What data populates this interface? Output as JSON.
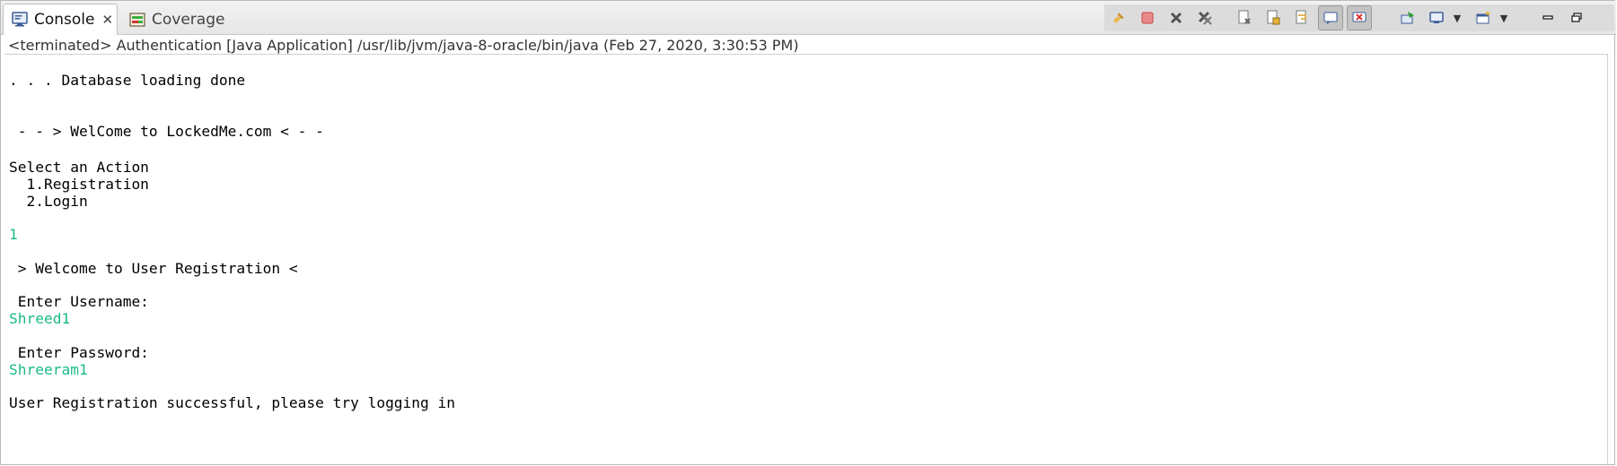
{
  "tabs": [
    {
      "label": "Console",
      "active": true,
      "close_glyph": "✕"
    },
    {
      "label": "Coverage",
      "active": false
    }
  ],
  "status_line": "<terminated> Authentication [Java Application] /usr/lib/jvm/java-8-oracle/bin/java (Feb 27, 2020, 3:30:53 PM)",
  "toolbar": {
    "icons": [
      "pin-icon",
      "terminate-icon",
      "remove-launch-icon",
      "remove-all-terminated-icon",
      "clear-console-icon",
      "scroll-lock-icon",
      "word-wrap-icon",
      "show-on-stdout-icon",
      "show-on-stderr-icon",
      "pin-console-icon",
      "display-console-icon",
      "open-console-icon",
      "minimize-icon",
      "maximize-icon"
    ]
  },
  "console_lines": [
    {
      "text": ". . . Database loading done",
      "type": "output"
    },
    {
      "text": " - - > WelCome to LockedMe.com < - -",
      "type": "output"
    },
    {
      "text": "Select an Action",
      "type": "output"
    },
    {
      "text": "  1.Registration",
      "type": "output"
    },
    {
      "text": "  2.Login",
      "type": "output"
    },
    {
      "text": "1",
      "type": "input"
    },
    {
      "text": " > Welcome to User Registration <",
      "type": "output"
    },
    {
      "text": " Enter Username:",
      "type": "output"
    },
    {
      "text": "Shreed1",
      "type": "input"
    },
    {
      "text": " Enter Password:",
      "type": "output"
    },
    {
      "text": "Shreeram1",
      "type": "input"
    },
    {
      "text": "User Registration successful, please try logging in",
      "type": "output"
    }
  ],
  "colors": {
    "input_text": "#1ab98a",
    "output_text": "#000000"
  }
}
